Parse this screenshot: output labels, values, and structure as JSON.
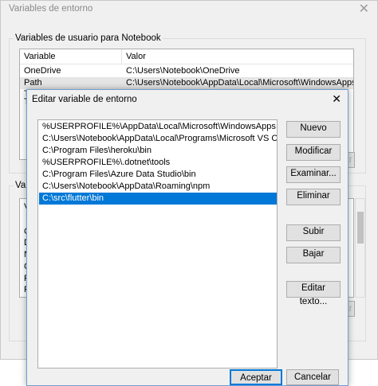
{
  "window": {
    "title": "Variables de entorno",
    "close_glyph": "✕",
    "user_group_label": "Variables de usuario para Notebook",
    "system_group_label": "Var",
    "columns": {
      "variable": "Variable",
      "valor": "Valor"
    },
    "user_vars": [
      {
        "name": "OneDrive",
        "value": "C:\\Users\\Notebook\\OneDrive"
      },
      {
        "name": "Path",
        "value": "C:\\Users\\Notebook\\AppData\\Local\\Microsoft\\WindowsApps;C:\\Us..."
      }
    ],
    "partial_rows_user": [
      "T",
      "T"
    ],
    "partial_rows_system": [
      "V",
      "C",
      "D",
      "N",
      "O",
      "P",
      "P",
      "P"
    ],
    "partial_button_right": "ar",
    "partial_button_right2": "ar"
  },
  "dialog": {
    "title": "Editar variable de entorno",
    "close_glyph": "✕",
    "paths": [
      "%USERPROFILE%\\AppData\\Local\\Microsoft\\WindowsApps",
      "C:\\Users\\Notebook\\AppData\\Local\\Programs\\Microsoft VS Code\\bin",
      "C:\\Program Files\\heroku\\bin",
      "%USERPROFILE%\\.dotnet\\tools",
      "C:\\Program Files\\Azure Data Studio\\bin",
      "C:\\Users\\Notebook\\AppData\\Roaming\\npm",
      "C:\\src\\flutter\\bin"
    ],
    "selected_index": 6,
    "buttons": {
      "nuevo": "Nuevo",
      "modificar": "Modificar",
      "examinar": "Examinar...",
      "eliminar": "Eliminar",
      "subir": "Subir",
      "bajar": "Bajar",
      "editar_texto": "Editar texto...",
      "aceptar": "Aceptar",
      "cancelar": "Cancelar"
    }
  }
}
